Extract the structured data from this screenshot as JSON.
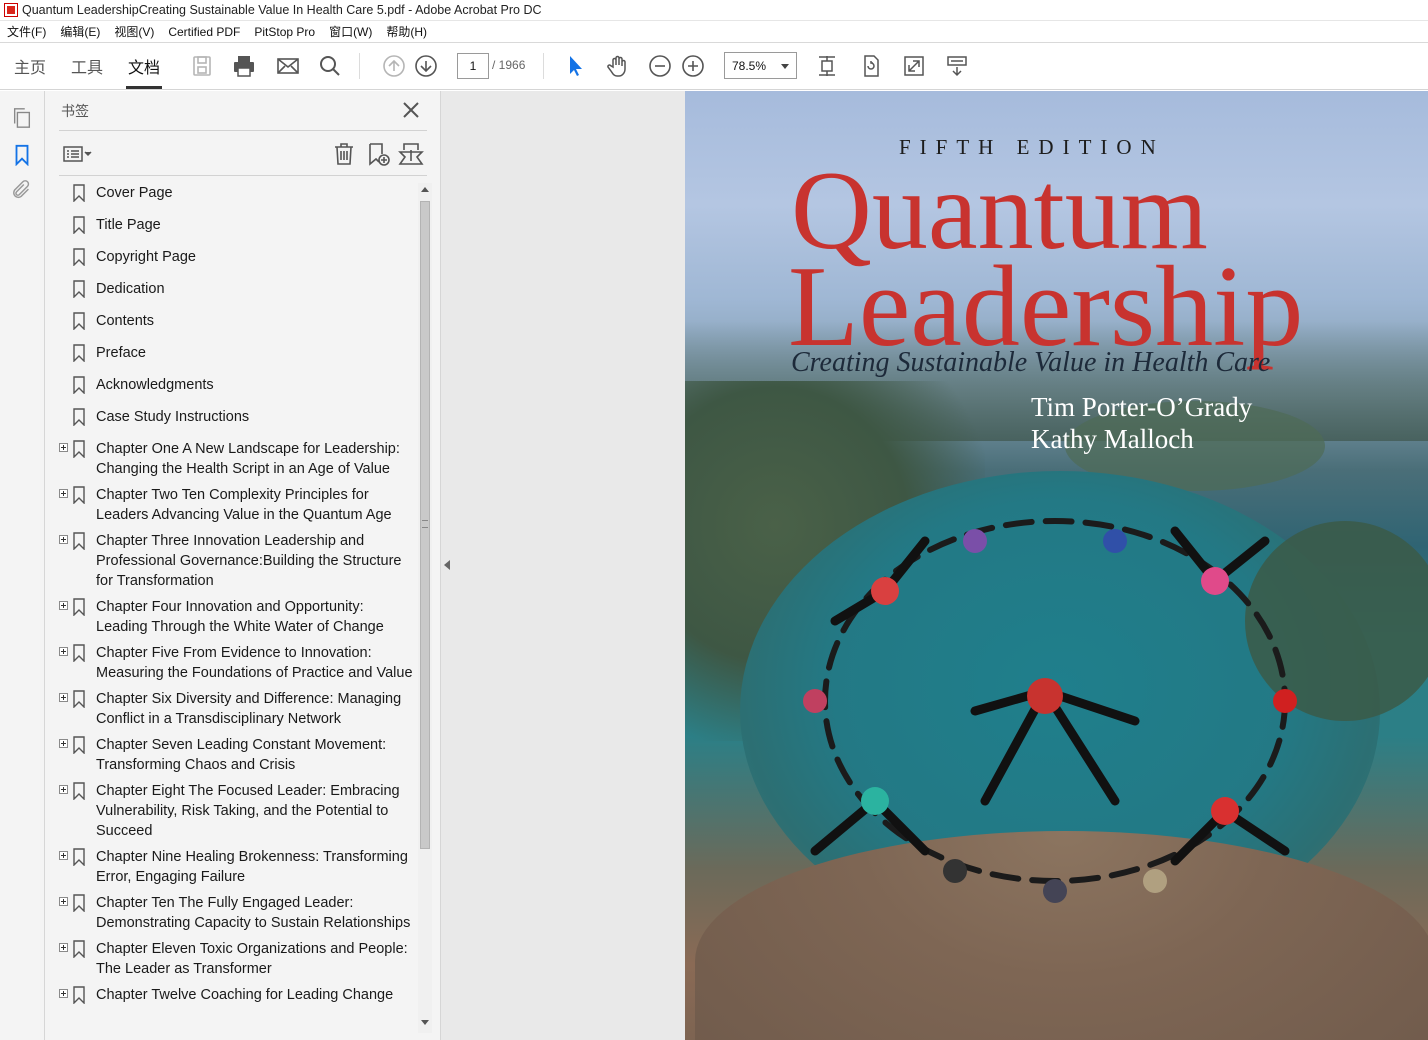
{
  "window": {
    "title": "Quantum LeadershipCreating Sustainable Value In Health Care 5.pdf - Adobe Acrobat Pro DC"
  },
  "menu": [
    "文件(F)",
    "编辑(E)",
    "视图(V)",
    "Certified PDF",
    "PitStop Pro",
    "窗口(W)",
    "帮助(H)"
  ],
  "tabs": {
    "home": "主页",
    "tools": "工具",
    "document": "文档"
  },
  "toolbar": {
    "page_number": "1",
    "page_total": "/ 1966",
    "zoom": "78.5%"
  },
  "bookmarks_panel": {
    "title": "书签",
    "items": [
      {
        "label": "Cover Page",
        "expandable": false
      },
      {
        "label": "Title Page",
        "expandable": false
      },
      {
        "label": "Copyright Page",
        "expandable": false
      },
      {
        "label": "Dedication",
        "expandable": false
      },
      {
        "label": "Contents",
        "expandable": false
      },
      {
        "label": "Preface",
        "expandable": false
      },
      {
        "label": "Acknowledgments",
        "expandable": false
      },
      {
        "label": "Case Study Instructions",
        "expandable": false
      },
      {
        "label": "Chapter One A New Landscape for Leadership: Changing the Health Script in an Age of Value",
        "expandable": true
      },
      {
        "label": "Chapter Two Ten Complexity Principles for Leaders Advancing Value in the Quantum Age",
        "expandable": true
      },
      {
        "label": "Chapter Three Innovation Leadership and Professional Governance:Building the Structure for Transformation",
        "expandable": true
      },
      {
        "label": "Chapter Four Innovation and Opportunity: Leading Through the White Water of Change",
        "expandable": true
      },
      {
        "label": "Chapter Five From Evidence to Innovation: Measuring the Foundations of Practice and Value",
        "expandable": true
      },
      {
        "label": "Chapter Six Diversity and Difference: Managing Conflict in a Transdisciplinary Network",
        "expandable": true
      },
      {
        "label": "Chapter Seven Leading Constant Movement: Transforming Chaos and Crisis",
        "expandable": true
      },
      {
        "label": "Chapter Eight The Focused Leader: Embracing Vulnerability, Risk Taking, and the Potential to Succeed",
        "expandable": true
      },
      {
        "label": "Chapter Nine Healing Brokenness: Transforming Error, Engaging Failure",
        "expandable": true
      },
      {
        "label": "Chapter Ten The Fully Engaged Leader: Demonstrating Capacity to Sustain Relationships",
        "expandable": true
      },
      {
        "label": "Chapter Eleven Toxic Organizations and People: The Leader as Transformer",
        "expandable": true
      },
      {
        "label": "Chapter Twelve Coaching for Leading Change",
        "expandable": true
      }
    ]
  },
  "cover": {
    "edition": "FIFTH EDITION",
    "title_line1": "Quantum",
    "title_line2": "Leadership",
    "subtitle": "Creating Sustainable Value in Health Care",
    "author1": "Tim Porter-O’Grady",
    "author2": "Kathy Malloch"
  },
  "colors": {
    "title_red": "#c8332f",
    "accent_blue": "#1473e6"
  }
}
